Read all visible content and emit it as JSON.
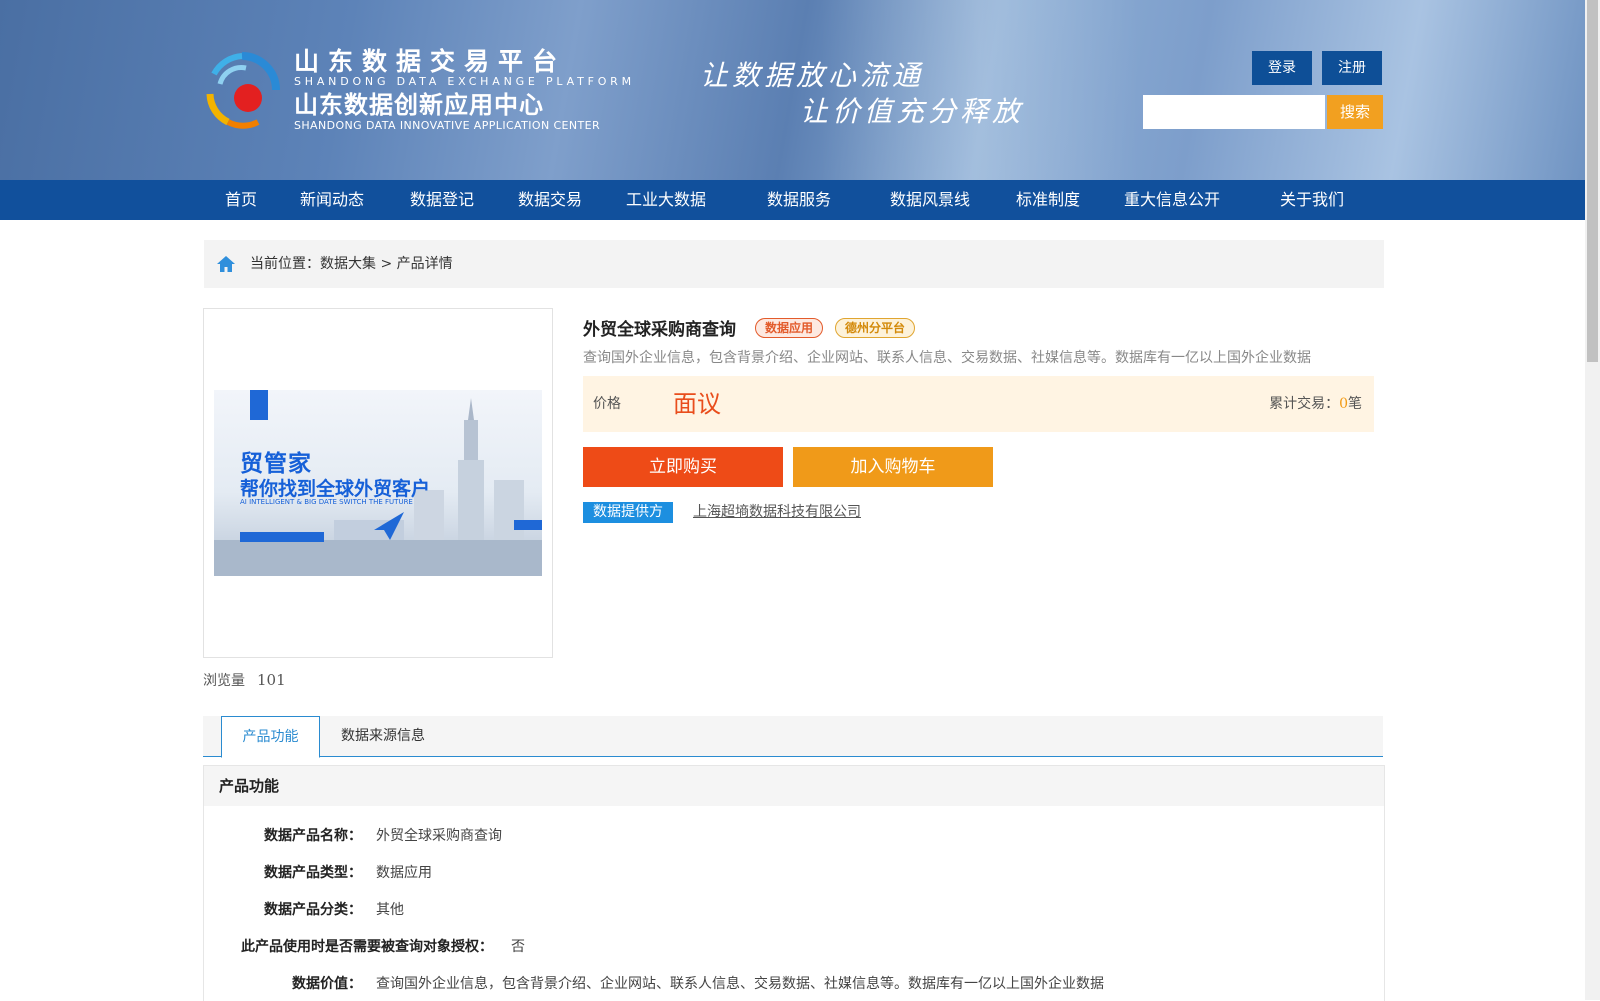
{
  "header": {
    "logo_cn1": "山东数据交易平台",
    "logo_en1": "SHANDONG DATA EXCHANGE PLATFORM",
    "logo_cn2": "山东数据创新应用中心",
    "logo_en2": "SHANDONG DATA INNOVATIVE APPLICATION CENTER",
    "slogan_line1": "让数据放心流通",
    "slogan_line2": "让价值充分释放",
    "login_label": "登录",
    "register_label": "注册",
    "search_value": "",
    "search_button": "搜索"
  },
  "nav": [
    "首页",
    "新闻动态",
    "数据登记",
    "数据交易",
    "工业大数据",
    "数据服务",
    "数据风景线",
    "标准制度",
    "重大信息公开",
    "关于我们"
  ],
  "breadcrumb": {
    "prefix": "当前位置：",
    "path": "数据大集 > 产品详情"
  },
  "image": {
    "headline": "贸管家",
    "subline": "帮你找到全球外贸客户",
    "tagline": "AI INTELLIGENT & BIG DATE SWITCH THE FUTURE"
  },
  "views": {
    "label": "浏览量",
    "count": "101"
  },
  "product": {
    "title": "外贸全球采购商查询",
    "badge_type": "数据应用",
    "badge_platform": "德州分平台",
    "description": "查询国外企业信息，包含背景介绍、企业网站、联系人信息、交易数据、社媒信息等。数据库有一亿以上国外企业数据",
    "price_label": "价格",
    "price_value": "面议",
    "accum_label": "累计交易：",
    "accum_count": "0",
    "accum_unit": "笔",
    "buy_label": "立即购买",
    "cart_label": "加入购物车",
    "provider_label": "数据提供方",
    "provider_name": "上海超墒数据科技有限公司"
  },
  "tabs": [
    "产品功能",
    "数据来源信息"
  ],
  "panel": {
    "heading": "产品功能",
    "rows": [
      {
        "key": "数据产品名称：",
        "value": "外贸全球采购商查询"
      },
      {
        "key": "数据产品类型：",
        "value": "数据应用"
      },
      {
        "key": "数据产品分类：",
        "value": "其他"
      },
      {
        "key": "此产品使用时是否需要被查询对象授权：",
        "value": "否"
      },
      {
        "key": "数据价值：",
        "value": "查询国外企业信息，包含背景介绍、企业网站、联系人信息、交易数据、社媒信息等。数据库有一亿以上国外企业数据"
      }
    ]
  },
  "colors": {
    "nav_bg": "#11509c",
    "buy": "#ee4b17",
    "cart": "#f09a19",
    "price": "#e94d1c",
    "provider": "#1d8fe0"
  }
}
